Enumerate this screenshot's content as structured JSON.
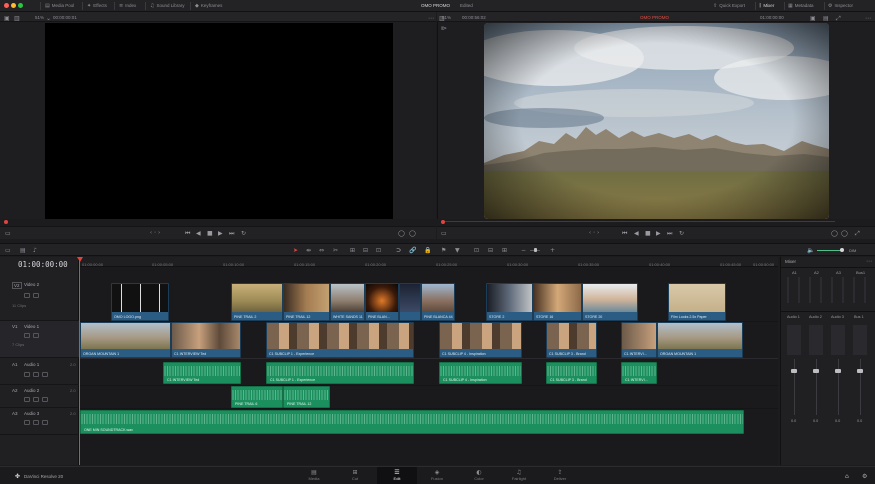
{
  "topbar": {
    "left_items": [
      {
        "label": "Media Pool",
        "icon": "media-pool-icon"
      },
      {
        "label": "Effects",
        "icon": "effects-icon"
      },
      {
        "label": "Index",
        "icon": "index-icon"
      },
      {
        "label": "Sound Library",
        "icon": "sound-library-icon"
      },
      {
        "label": "Keyframes",
        "icon": "keyframes-icon"
      }
    ],
    "project_title": "OMO PROMO",
    "project_status": "Edited",
    "right_items": [
      {
        "label": "Quick Export",
        "icon": "export-icon"
      },
      {
        "label": "Mixer",
        "icon": "mixer-icon"
      },
      {
        "label": "Metadata",
        "icon": "metadata-icon"
      },
      {
        "label": "Inspector",
        "icon": "inspector-icon"
      }
    ]
  },
  "source_viewer": {
    "zoom": "51%",
    "timecode": "00:00:00:01"
  },
  "program_viewer": {
    "zoom": "51%",
    "duration": "00:00:56:02",
    "timeline_name": "OMO PROMO",
    "timecode": "01:00:00:00"
  },
  "timeline": {
    "timecode": "01:00:00:00",
    "ruler_ticks": [
      "01:00:00:00",
      "01:00:05:00",
      "01:00:10:00",
      "01:00:15:00",
      "01:00:20:00",
      "01:00:25:00",
      "01:00:30:00",
      "01:00:35:00",
      "01:00:40:00",
      "01:00:45:00",
      "01:00:50:00"
    ],
    "tracks": {
      "v2": {
        "id": "V2",
        "name": "Video 2",
        "count": "11 Clips"
      },
      "v1": {
        "id": "V1",
        "name": "Video 1",
        "count": "7 Clips"
      },
      "a1": {
        "id": "A1",
        "name": "Audio 1",
        "level": "2.0"
      },
      "a2": {
        "id": "A2",
        "name": "Audio 2",
        "level": "2.0"
      },
      "a3": {
        "id": "A3",
        "name": "Audio 3",
        "level": "2.0"
      }
    },
    "v2_clips": [
      "OMO LOGO.png",
      "PINE TRAIL 2",
      "PINE TRAIL 12",
      "WHITE SANDS 11",
      "PINE BLAN...",
      "PINE BLANCA 44",
      "STORE 2",
      "STORE 16",
      "STORE 20",
      "Film Looks 2.5x Paper"
    ],
    "v1_clips": [
      "ORGAN MOUNTAIN 1",
      "C1 INTERVIEW Ted",
      "C1 SUBCLIP 1 - Experience",
      "C1 SUBCLIP 4 - Inspiration",
      "C1 SUBCLIP 3 - Brand",
      "C1 INTERVI...",
      "ORGAN MOUNTAIN 1"
    ],
    "a1_clips": [
      "C1 INTERVIEW Ted",
      "C1 SUBCLIP 1 - Experience",
      "C1 SUBCLIP 4 - Inspiration",
      "C1 SUBCLIP 3 - Brand",
      "C1 INTERVI..."
    ],
    "a2_clips": [
      "PINE TRAIL 6",
      "PINE TRAIL 12"
    ],
    "a3_clips": [
      "ONE MIN SOUNDTRACK.wav"
    ]
  },
  "mixer": {
    "title": "Mixer",
    "channels": [
      "A1",
      "A2",
      "A3",
      "Bus1"
    ],
    "strip_labels": [
      "Audio 1",
      "Audio 2",
      "Audio 3",
      "Bus 1"
    ],
    "levels": [
      "0.0",
      "0.0",
      "0.0",
      "0.0"
    ],
    "volume_label": "DIM"
  },
  "pages": [
    {
      "label": "Media",
      "icon": "media-page-icon"
    },
    {
      "label": "Cut",
      "icon": "cut-page-icon"
    },
    {
      "label": "Edit",
      "icon": "edit-page-icon"
    },
    {
      "label": "Fusion",
      "icon": "fusion-page-icon"
    },
    {
      "label": "Color",
      "icon": "color-page-icon"
    },
    {
      "label": "Fairlight",
      "icon": "fairlight-page-icon"
    },
    {
      "label": "Deliver",
      "icon": "deliver-page-icon"
    }
  ],
  "app_name": "DaVinci Resolve 20",
  "colors": {
    "video_clip": "#2b5d84",
    "audio_clip": "#1c8f5e",
    "playhead": "#e0443c",
    "active_timeline": "#e04c3f"
  }
}
